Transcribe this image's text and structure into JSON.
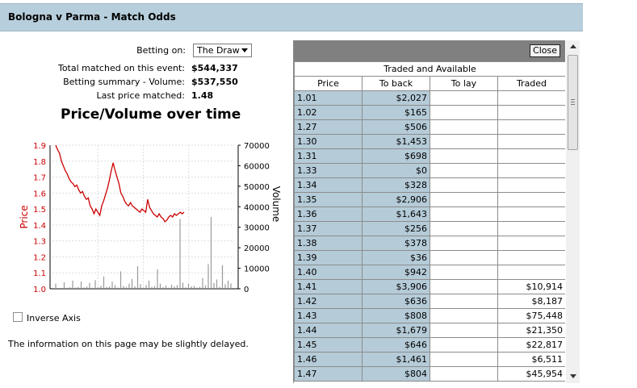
{
  "header": {
    "title": "Bologna v Parma - Match Odds"
  },
  "info": {
    "betting_on_label": "Betting on:",
    "betting_on_value": "The Draw",
    "total_matched_label": "Total matched on this event:",
    "total_matched_value": "$544,337",
    "summary_label": "Betting summary - Volume:",
    "summary_value": "$537,550",
    "last_price_label": "Last price matched:",
    "last_price_value": "1.48"
  },
  "chart_data": {
    "type": "line",
    "title": "Price/Volume over time",
    "ylabel": "Price",
    "y2label": "Volume",
    "ylim": [
      1.0,
      1.9
    ],
    "y2lim": [
      0,
      70000
    ],
    "y_ticks": [
      "1.0",
      "1.1",
      "1.2",
      "1.3",
      "1.4",
      "1.5",
      "1.6",
      "1.7",
      "1.8",
      "1.9"
    ],
    "y2_ticks": [
      "0",
      "10000",
      "20000",
      "30000",
      "40000",
      "50000",
      "60000",
      "70000"
    ],
    "grid": true,
    "series": [
      {
        "axis": "left",
        "color": "#cc0000",
        "values": [
          1.9,
          1.87,
          1.85,
          1.8,
          1.77,
          1.74,
          1.72,
          1.69,
          1.67,
          1.66,
          1.64,
          1.65,
          1.62,
          1.6,
          1.61,
          1.58,
          1.56,
          1.57,
          1.52,
          1.5,
          1.47,
          1.5,
          1.48,
          1.46,
          1.52,
          1.55,
          1.59,
          1.63,
          1.68,
          1.74,
          1.79,
          1.74,
          1.7,
          1.66,
          1.6,
          1.58,
          1.55,
          1.53,
          1.52,
          1.54,
          1.52,
          1.51,
          1.5,
          1.49,
          1.48,
          1.5,
          1.49,
          1.48,
          1.56,
          1.51,
          1.49,
          1.47,
          1.46,
          1.45,
          1.47,
          1.45,
          1.44,
          1.42,
          1.43,
          1.45,
          1.46,
          1.45,
          1.47,
          1.46,
          1.47,
          1.48,
          1.47,
          1.48
        ]
      },
      {
        "axis": "right",
        "color": "#9a9a9a",
        "values": [
          2500,
          300,
          400,
          3200,
          500,
          800,
          4000,
          600,
          900,
          3500,
          700,
          1100,
          2800,
          500,
          4200,
          800,
          1500,
          6000,
          900,
          1200,
          3500,
          1800,
          600,
          8500,
          1400,
          900,
          2500,
          4800,
          1200,
          11000,
          2200,
          600,
          1800,
          4000,
          900,
          1400,
          9500,
          2500,
          800,
          1600,
          500,
          2000,
          1100,
          1800,
          34000,
          3000,
          700,
          2500,
          1200,
          1400,
          600,
          900,
          5200,
          1700,
          12000,
          35000,
          2800,
          4500,
          1000,
          11500,
          2200,
          4000,
          2600
        ]
      }
    ]
  },
  "controls": {
    "inverse_axis_label": "Inverse Axis"
  },
  "notice": "The information on this page may be slightly delayed.",
  "panel": {
    "close_label": "Close",
    "section_title": "Traded and Available",
    "columns": [
      "Price",
      "To back",
      "To lay",
      "Traded"
    ],
    "rows": [
      {
        "price": "1.01",
        "back": "$2,027",
        "lay": "",
        "traded": ""
      },
      {
        "price": "1.02",
        "back": "$165",
        "lay": "",
        "traded": ""
      },
      {
        "price": "1.27",
        "back": "$506",
        "lay": "",
        "traded": ""
      },
      {
        "price": "1.30",
        "back": "$1,453",
        "lay": "",
        "traded": ""
      },
      {
        "price": "1.31",
        "back": "$698",
        "lay": "",
        "traded": ""
      },
      {
        "price": "1.33",
        "back": "$0",
        "lay": "",
        "traded": ""
      },
      {
        "price": "1.34",
        "back": "$328",
        "lay": "",
        "traded": ""
      },
      {
        "price": "1.35",
        "back": "$2,906",
        "lay": "",
        "traded": ""
      },
      {
        "price": "1.36",
        "back": "$1,643",
        "lay": "",
        "traded": ""
      },
      {
        "price": "1.37",
        "back": "$256",
        "lay": "",
        "traded": ""
      },
      {
        "price": "1.38",
        "back": "$378",
        "lay": "",
        "traded": ""
      },
      {
        "price": "1.39",
        "back": "$36",
        "lay": "",
        "traded": ""
      },
      {
        "price": "1.40",
        "back": "$942",
        "lay": "",
        "traded": ""
      },
      {
        "price": "1.41",
        "back": "$3,906",
        "lay": "",
        "traded": "$10,914"
      },
      {
        "price": "1.42",
        "back": "$636",
        "lay": "",
        "traded": "$8,187"
      },
      {
        "price": "1.43",
        "back": "$808",
        "lay": "",
        "traded": "$75,448"
      },
      {
        "price": "1.44",
        "back": "$1,679",
        "lay": "",
        "traded": "$21,350"
      },
      {
        "price": "1.45",
        "back": "$646",
        "lay": "",
        "traded": "$22,817"
      },
      {
        "price": "1.46",
        "back": "$1,461",
        "lay": "",
        "traded": "$6,511"
      },
      {
        "price": "1.47",
        "back": "$804",
        "lay": "",
        "traded": "$45,954"
      }
    ]
  }
}
